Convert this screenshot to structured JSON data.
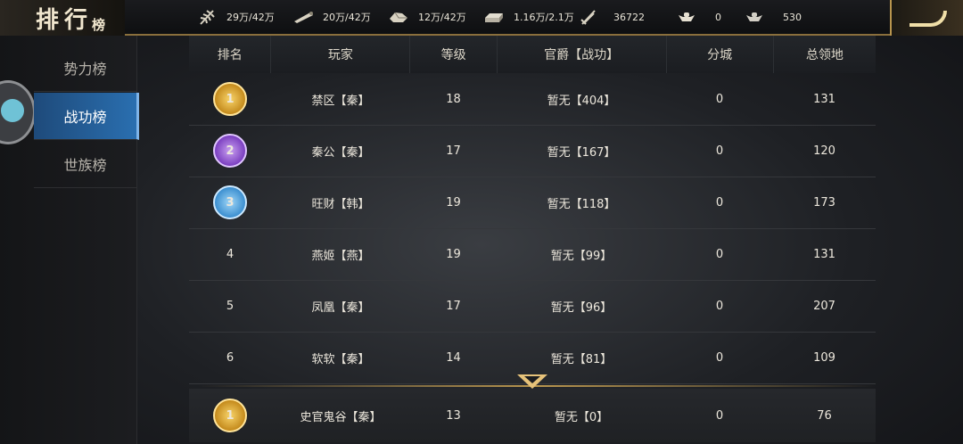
{
  "header": {
    "title": "排行",
    "title_sub": "榜",
    "resources": [
      {
        "icon": "wheat-icon",
        "value": "29万/42万"
      },
      {
        "icon": "wood-icon",
        "value": "20万/42万"
      },
      {
        "icon": "stone-icon",
        "value": "12万/42万"
      },
      {
        "icon": "iron-icon",
        "value": "1.16万/2.1万"
      },
      {
        "icon": "sword-icon",
        "value": "36722"
      },
      {
        "icon": "gold-ingot-icon",
        "value": "0"
      },
      {
        "icon": "silver-ingot-icon",
        "value": "530"
      }
    ]
  },
  "sidebar": {
    "items": [
      {
        "label": "势力榜"
      },
      {
        "label": "战功榜"
      },
      {
        "label": "世族榜"
      }
    ],
    "active_index": 1
  },
  "table": {
    "columns": [
      "排名",
      "玩家",
      "等级",
      "官爵【战功】",
      "分城",
      "总领地"
    ],
    "rows": [
      {
        "rank": "1",
        "player": "禁区【秦】",
        "level": "18",
        "title": "暂无【404】",
        "branch": "0",
        "territory": "131"
      },
      {
        "rank": "2",
        "player": "秦公【秦】",
        "level": "17",
        "title": "暂无【167】",
        "branch": "0",
        "territory": "120"
      },
      {
        "rank": "3",
        "player": "旺财【韩】",
        "level": "19",
        "title": "暂无【118】",
        "branch": "0",
        "territory": "173"
      },
      {
        "rank": "4",
        "player": "燕姬【燕】",
        "level": "19",
        "title": "暂无【99】",
        "branch": "0",
        "territory": "131"
      },
      {
        "rank": "5",
        "player": "凤凰【秦】",
        "level": "17",
        "title": "暂无【96】",
        "branch": "0",
        "territory": "207"
      },
      {
        "rank": "6",
        "player": "软软【秦】",
        "level": "14",
        "title": "暂无【81】",
        "branch": "0",
        "territory": "109"
      }
    ],
    "my_row": {
      "rank": "1",
      "player": "史官鬼谷【秦】",
      "level": "13",
      "title": "暂无【0】",
      "branch": "0",
      "territory": "76"
    }
  },
  "colors": {
    "accent_gold": "#b8954e",
    "active_tab": "#2a6fb0"
  }
}
